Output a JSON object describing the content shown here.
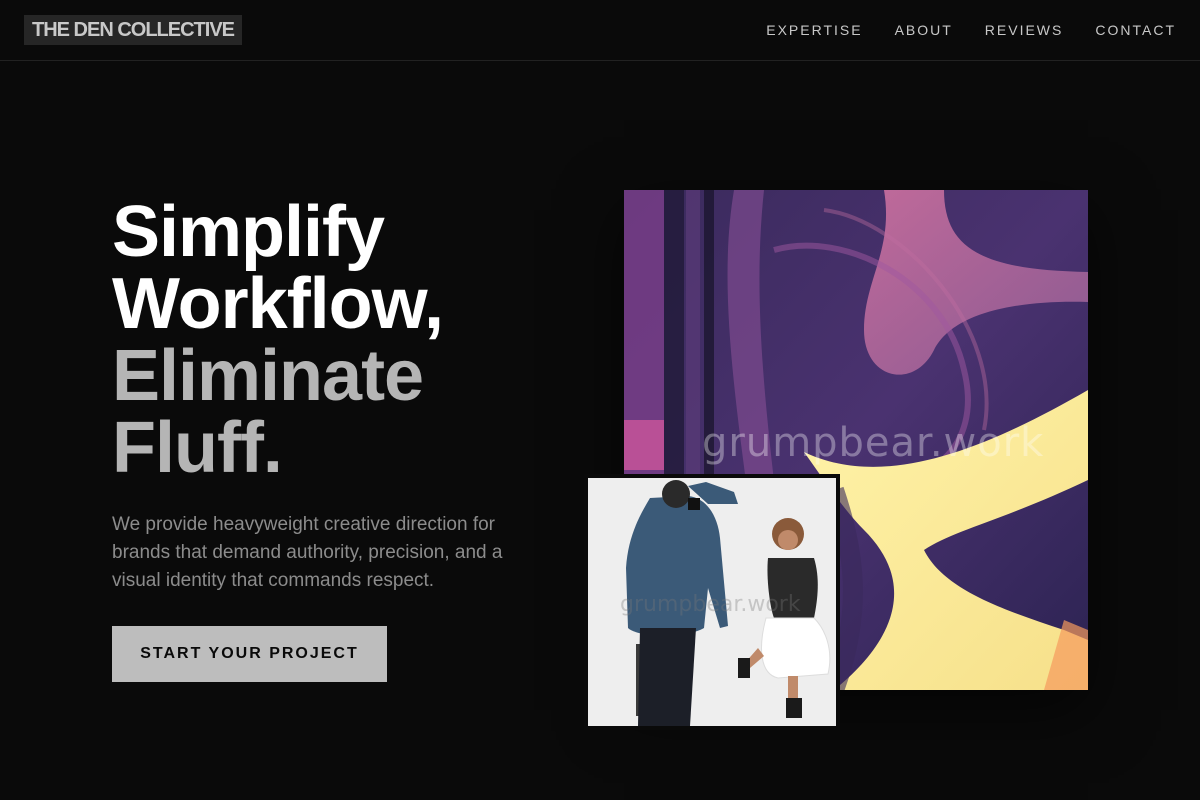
{
  "brand": {
    "name": "THE DEN COLLECTIVE"
  },
  "nav": {
    "items": [
      "EXPERTISE",
      "ABOUT",
      "REVIEWS",
      "CONTACT"
    ]
  },
  "hero": {
    "title_line1": "Simplify",
    "title_line2": "Workflow,",
    "title_line3": "Eliminate",
    "title_line4": "Fluff.",
    "subtitle": "We provide heavyweight creative direction for brands that demand authority, precision, and a visual identity that commands respect.",
    "cta_label": "START YOUR PROJECT"
  },
  "media": {
    "art_watermark": "grumpbear.work",
    "photo_watermark": "grumpbear.work"
  },
  "colors": {
    "background": "#0a0a0a",
    "headline_primary": "#ffffff",
    "headline_secondary": "#b5b5b5",
    "cta_background": "#bdbdbd"
  }
}
